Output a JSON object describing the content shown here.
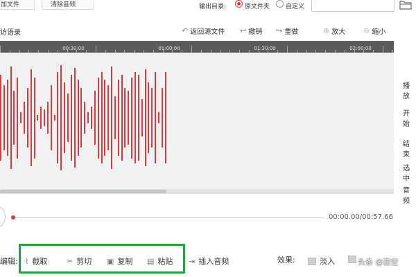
{
  "toolbar_top": {
    "add_file_label": "加文件",
    "clear_audio_label": "清除音频",
    "output_dir_label": "输出目录:",
    "radio_original_folder": "原文件夹",
    "radio_custom": "自定义",
    "output_path_value": ""
  },
  "editor_toolbar": {
    "file_name": "访语录",
    "return_label": "返回源文件",
    "undo_label": "撤销",
    "redo_label": "重做",
    "zoom_in_label": "放大",
    "zoom_out_label": "缩小"
  },
  "timeline": {
    "labels": [
      "00:30:00",
      "01:00:00",
      "01:30:00",
      "02:00:00"
    ]
  },
  "waveform": {
    "color": "#d63a3f",
    "amplitudes": [
      0.8,
      0.6,
      0.7,
      0.95,
      0.5,
      0.75,
      0.1,
      0.3,
      0.55,
      0.9,
      0.75,
      0.05,
      0.2,
      0.15,
      0.3,
      0.6,
      0.05,
      0.85,
      0.98,
      0.65,
      0.45,
      0.8,
      0.92,
      0.7,
      0.55,
      0.3,
      0.1,
      0.2,
      0.5,
      0.75,
      0.85,
      0.7,
      0.6,
      0.95,
      0.4,
      0.7,
      0.8,
      0.55,
      0.5,
      0.75,
      0.85,
      0.8,
      0.35,
      0.9,
      0.65,
      0.55,
      0.85,
      0.1,
      0.55,
      0.85
    ]
  },
  "side_panel": {
    "labels": [
      "播放",
      "开始",
      "结束",
      "选中",
      "音频"
    ]
  },
  "playback": {
    "time_readout": "00:00.00/00:57.66",
    "progress_fraction": 0.0
  },
  "edit_row": {
    "edit_label": "编辑:",
    "cut_label": "截取",
    "trim_label": "剪切",
    "copy_label": "复制",
    "paste_label": "粘贴",
    "insert_audio_label": "插入音频",
    "effects_label": "效果:",
    "fade_in_label": "淡入",
    "highlight_color": "#1fa33a"
  },
  "watermark": "头条 @恋空"
}
